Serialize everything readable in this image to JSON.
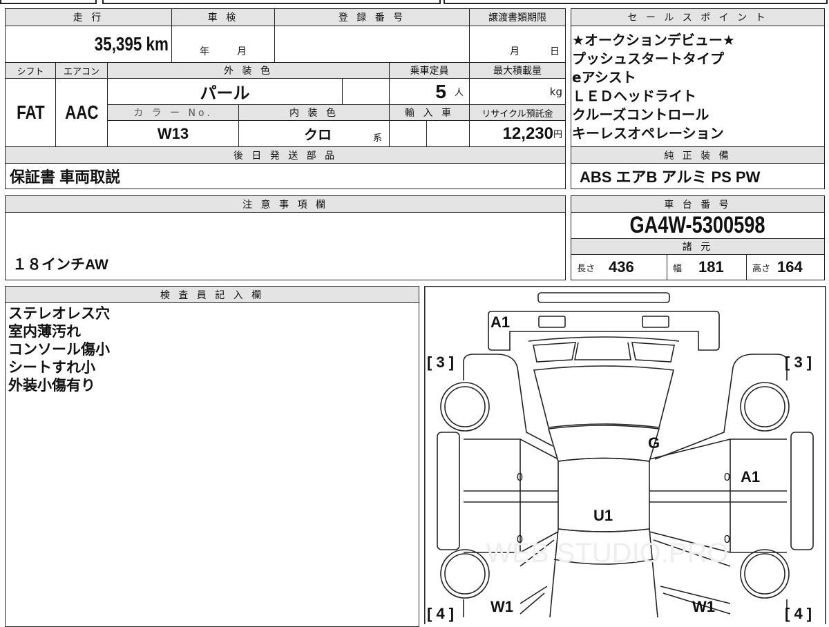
{
  "main": {
    "mileage_label": "走 行",
    "mileage": "35,395 km",
    "inspection_label": "車 検",
    "inspection_year": "年",
    "inspection_month": "月",
    "registration_label": "登 録 番 号",
    "registration_value": "",
    "transfer_label": "譲渡書類期限",
    "transfer_month": "月",
    "transfer_day": "日",
    "shift_label": "シフト",
    "shift": "FAT",
    "ac_label": "エアコン",
    "ac": "AAC",
    "exterior_label": "外 装 色",
    "exterior": "パール",
    "capacity_label": "乗車定員",
    "capacity": "5",
    "capacity_unit": "人",
    "load_label": "最大積載量",
    "load_unit": "kg",
    "color_no_label": "カ ラ ー No.",
    "color_no": "W13",
    "interior_label": "内 装 色",
    "interior": "クロ",
    "interior_suffix": "系",
    "import_label": "輸 入 車",
    "recycle_label": "リサイクル預託金",
    "recycle": "12,230",
    "recycle_unit": "円",
    "later_parts_label": "後 日 発 送 部 品",
    "later_parts": "保証書 車両取説"
  },
  "sales": {
    "label": "セ ー ル ス ポ イ ン ト",
    "points": [
      "★オークションデビュー★",
      "プッシュスタートタイプ",
      "eアシスト",
      "ＬＥＤヘッドライト",
      "クルーズコントロール",
      "キーレスオペレーション"
    ]
  },
  "equipment": {
    "label": "純 正 装 備",
    "value": "ABS エアB アルミ PS PW"
  },
  "notes": {
    "label": "注 意 事 項 欄",
    "value": "１８インチAW"
  },
  "chassis": {
    "label": "車 台 番 号",
    "value": "GA4W-5300598"
  },
  "specs": {
    "label": "諸 元",
    "length_label": "長さ",
    "length": "436",
    "width_label": "幅",
    "width": "181",
    "height_label": "高さ",
    "height": "164"
  },
  "inspector": {
    "label": "検 査 員 記 入 欄",
    "lines": [
      "ステレオレス穴",
      "室内薄汚れ",
      "コンソール傷小",
      "シートすれ小",
      "外装小傷有り"
    ]
  },
  "diagram": {
    "front_bumper": "A1",
    "fender_left": "[ 3 ]",
    "fender_right": "[ 3 ]",
    "roof": "G",
    "cabin": "U1",
    "door_right": "A1",
    "door_marks": [
      "0",
      "0",
      "0",
      "0"
    ],
    "rear_left": "W1",
    "rear_right": "W1",
    "quarter_left": "[ 4 ]",
    "quarter_right": "[ 4 ]"
  }
}
